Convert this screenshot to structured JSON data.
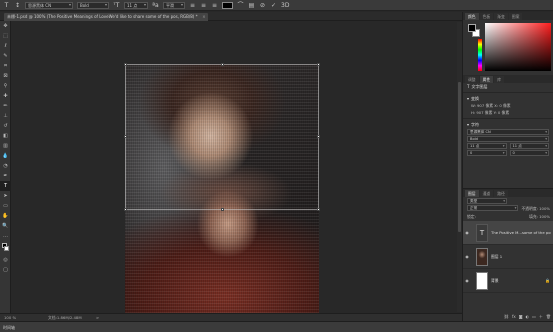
{
  "options_bar": {
    "tool_icon": "text-tool-icon",
    "orientation_icon": "text-orientation-icon",
    "font_family": "思源黑体 CN",
    "font_style": "Bold",
    "font_size": "11 点",
    "anti_alias": "平滑",
    "color_hex": "#000000",
    "icons": [
      "align-left-icon",
      "align-center-icon",
      "align-right-icon",
      "warp-text-icon",
      "character-panel-icon",
      "cancel-icon",
      "commit-check-icon",
      "3d-icon"
    ]
  },
  "document": {
    "tab_title": "未標-1.psd @ 100% (The Positive Meanings of LoveWe'd like to share some of the pos, RGB/8) *",
    "close_label": "×"
  },
  "status": {
    "zoom": "100 %",
    "doc_size": "文档:1.86M/2.48M",
    "arrow": ">"
  },
  "bottom": {
    "timeline_label": "时间轴"
  },
  "right_panel": {
    "color_tabs": [
      "颜色",
      "色板",
      "渐变",
      "图案"
    ],
    "props_tabs": [
      "调整",
      "属性",
      "库"
    ],
    "layer_kind": "文字图层",
    "transform_title": "变换",
    "transform_w": "W: 907 像素",
    "transform_h": "H: 907 像素",
    "transform_x": "X: 0 像素",
    "transform_y": "Y: 0 像素",
    "char_title": "字符",
    "char_font": "思源黑体 CN",
    "char_style": "Bold",
    "char_size": "11 点",
    "char_leading": "11 点",
    "char_tracking": "0",
    "char_kerning": "0"
  },
  "layers_panel": {
    "tabs": [
      "图层",
      "通道",
      "路径"
    ],
    "filter_label": "类型",
    "blend_mode": "正常",
    "opacity_label": "不透明度: 100%",
    "lock_label": "锁定:",
    "fill_label": "填充: 100%",
    "layers": [
      {
        "name": "The Positive M...some of the pos",
        "kind": "text",
        "selected": true,
        "thumb_glyph": "T"
      },
      {
        "name": "图层 1",
        "kind": "photo",
        "selected": false,
        "thumb_glyph": ""
      },
      {
        "name": "背景",
        "kind": "background",
        "selected": false,
        "thumb_glyph": ""
      }
    ],
    "footer_icons": [
      "link-icon",
      "fx-icon",
      "mask-icon",
      "adjustment-icon",
      "group-icon",
      "new-layer-icon",
      "trash-icon"
    ]
  }
}
